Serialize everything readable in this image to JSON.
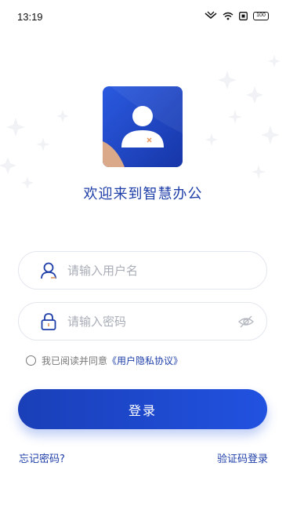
{
  "status_bar": {
    "time": "13:19",
    "battery_level": "100",
    "icons": [
      "nfc-icon",
      "wifi-icon",
      "sim-icon",
      "battery-icon"
    ]
  },
  "app": {
    "title": "欢迎来到智慧办公",
    "logo_icon": "user-avatar-icon"
  },
  "login_form": {
    "username_placeholder": "请输入用户名",
    "password_placeholder": "请输入密码",
    "agreement_text": "我已阅读并同意",
    "agreement_link": "《用户隐私协议》",
    "agreement_checked": false,
    "login_label": "登录"
  },
  "footer": {
    "forgot_password": "忘记密码?",
    "sms_login": "验证码登录"
  },
  "colors": {
    "primary": "#1e3ea8",
    "button_start": "#1a3fb8",
    "button_end": "#2152e0",
    "placeholder": "#a9adb7",
    "border": "#e3e6ee"
  }
}
